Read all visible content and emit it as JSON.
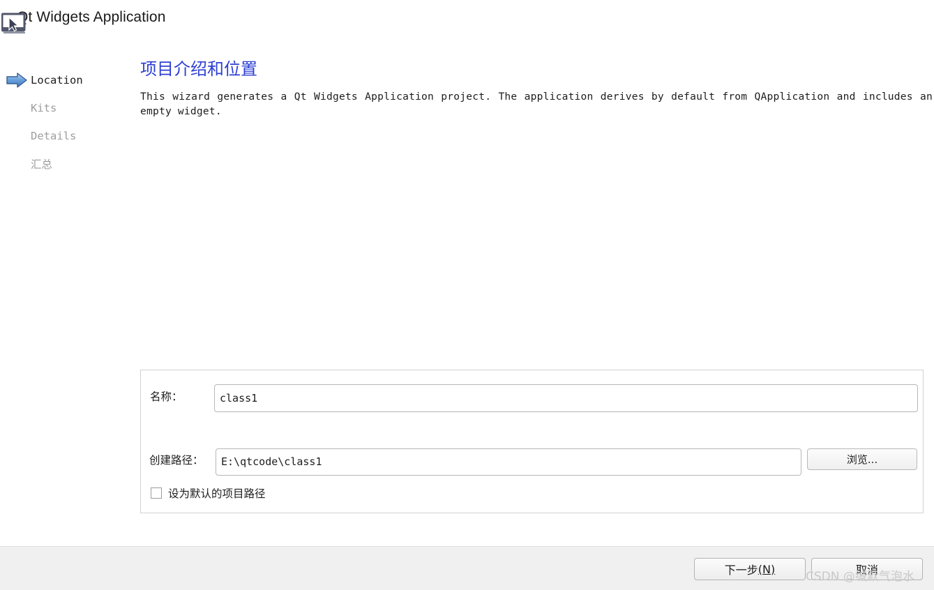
{
  "window": {
    "title": "Qt Widgets Application",
    "icon": "monitor-cursor-icon"
  },
  "sidebar": {
    "items": [
      {
        "label": "Location",
        "active": true
      },
      {
        "label": "Kits",
        "active": false
      },
      {
        "label": "Details",
        "active": false
      },
      {
        "label": "汇总",
        "active": false
      }
    ],
    "active_marker_icon": "blue-right-arrow-icon"
  },
  "main": {
    "heading": "项目介绍和位置",
    "description": "This wizard generates a Qt Widgets Application project. The application derives by default from QApplication and includes an empty widget."
  },
  "form": {
    "name_label": "名称：",
    "name_value": "class1",
    "path_label": "创建路径：",
    "path_value": "E:\\qtcode\\class1",
    "browse_label": "浏览...",
    "checkbox_label": "设为默认的项目路径",
    "checkbox_checked": false
  },
  "footer": {
    "next_label": "下一步",
    "next_mnemonic": "(N)",
    "cancel_label": "取消"
  },
  "watermark": {
    "text": "CSDN @缄默气泡水"
  },
  "colors": {
    "heading": "#2d3fd3",
    "arrow": "#4a8fdc",
    "sidebar_inactive": "#9d9d9d",
    "footer_bg": "#f0f0f0",
    "panel_border": "#d2d2d2"
  }
}
